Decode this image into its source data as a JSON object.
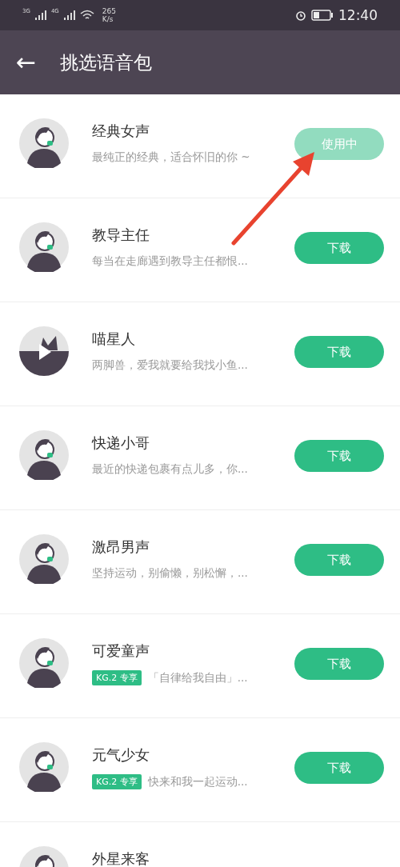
{
  "status_bar": {
    "net_label_1": "3G",
    "net_label_2": "4G",
    "speed_value": "265",
    "speed_unit": "K/s",
    "time": "12:40"
  },
  "header": {
    "back": "←",
    "title": "挑选语音包"
  },
  "voice_packs": [
    {
      "kind": "figure",
      "name": "经典女声",
      "description": "最纯正的经典，适合怀旧的你 ~",
      "button": "使用中",
      "in_use": true
    },
    {
      "kind": "figure",
      "name": "教导主任",
      "description": "每当在走廊遇到教导主任都恨...",
      "button": "下载",
      "in_use": false
    },
    {
      "kind": "cat",
      "name": "喵星人",
      "description": "两脚兽，爱我就要给我找小鱼...",
      "button": "下载",
      "in_use": false
    },
    {
      "kind": "figure",
      "name": "快递小哥",
      "description": "最近的快递包裹有点儿多，你...",
      "button": "下载",
      "in_use": false
    },
    {
      "kind": "figure",
      "name": "激昂男声",
      "description": "坚持运动，别偷懒，别松懈，...",
      "button": "下载",
      "in_use": false
    },
    {
      "kind": "figure",
      "name": "可爱童声",
      "tag": "KG.2 专享",
      "description": "「自律给我自由」...",
      "button": "下载",
      "in_use": false
    },
    {
      "kind": "figure",
      "name": "元气少女",
      "tag": "KG.2 专享",
      "description": "快来和我一起运动...",
      "button": "下载",
      "in_use": false
    },
    {
      "kind": "figure",
      "name": "外星来客"
    }
  ]
}
